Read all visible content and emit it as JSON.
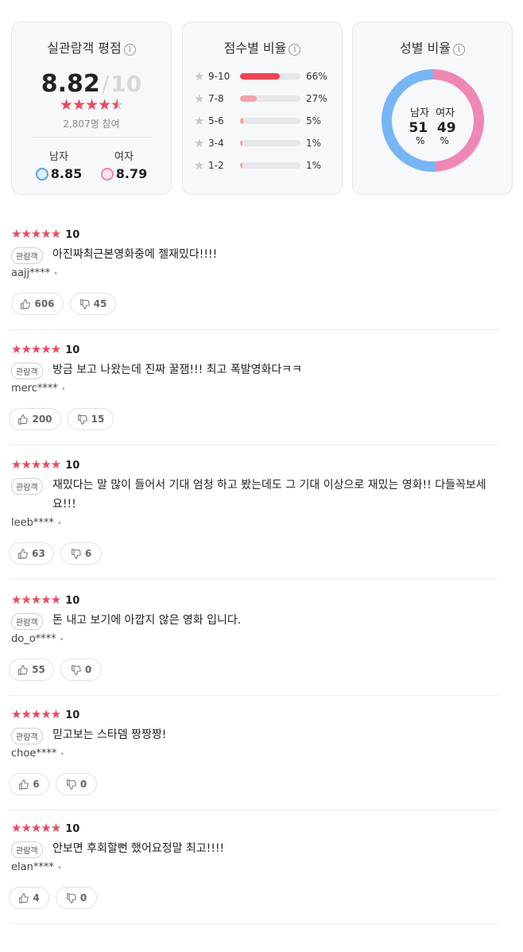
{
  "rating_card": {
    "title": "실관람객 평점",
    "info": "i",
    "score": "8.82",
    "sep": "/",
    "max": "10",
    "stars_full": "★★★★",
    "stars_half": "★",
    "stars_empty": "★",
    "participants": "2,807명 참여",
    "male_label": "남자",
    "male_score": "8.85",
    "female_label": "여자",
    "female_score": "8.79"
  },
  "dist_card": {
    "title": "점수별 비율",
    "info": "i",
    "rows": [
      {
        "label": "9-10",
        "pct": "66%",
        "value": 0.66,
        "color": "#ef4452"
      },
      {
        "label": "7-8",
        "pct": "27%",
        "value": 0.27,
        "color": "#f3a3a9"
      },
      {
        "label": "5-6",
        "pct": "5%",
        "value": 0.05,
        "color": "#f3a3a9"
      },
      {
        "label": "3-4",
        "pct": "1%",
        "value": 0.01,
        "color": "#f3a3a9"
      },
      {
        "label": "1-2",
        "pct": "1%",
        "value": 0.01,
        "color": "#f3a3a9"
      }
    ]
  },
  "gender_card": {
    "title": "성별 비율",
    "info": "i",
    "male_label": "남자",
    "female_label": "여자",
    "male_value": "51",
    "female_value": "49",
    "unit": "%",
    "male_color": "#76b6f5",
    "female_color": "#ef87b4"
  },
  "reviews": [
    {
      "stars": "★★★★★",
      "score": "10",
      "badge": "관람객",
      "text": "아진짜최근본영화중에 젤재밌다!!!!",
      "user": "aajj****",
      "likes": "606",
      "dislikes": "45"
    },
    {
      "stars": "★★★★★",
      "score": "10",
      "badge": "관람객",
      "text": "방금 보고 나왔는데 진짜 꿀잼!!! 최고 폭발영화다ㅋㅋ",
      "user": "merc****",
      "likes": "200",
      "dislikes": "15"
    },
    {
      "stars": "★★★★★",
      "score": "10",
      "badge": "관람객",
      "text": "재밌다는 말 많이 들어서 기대 엄청 하고 봤는데도 그 기대 이상으로 재밌는 영화!! 다들꼭보세요!!!",
      "user": "leeb****",
      "likes": "63",
      "dislikes": "6"
    },
    {
      "stars": "★★★★★",
      "score": "10",
      "badge": "관람객",
      "text": "돈 내고 보기에 아깝지 않은 영화 입니다.",
      "user": "do_o****",
      "likes": "55",
      "dislikes": "0"
    },
    {
      "stars": "★★★★★",
      "score": "10",
      "badge": "관람객",
      "text": "믿고보는 스타뎀 짱짱짱!",
      "user": "choe****",
      "likes": "6",
      "dislikes": "0"
    },
    {
      "stars": "★★★★★",
      "score": "10",
      "badge": "관람객",
      "text": "안보면 후회할뻔 했어요정말 최고!!!!",
      "user": "elan****",
      "likes": "4",
      "dislikes": "0"
    }
  ]
}
